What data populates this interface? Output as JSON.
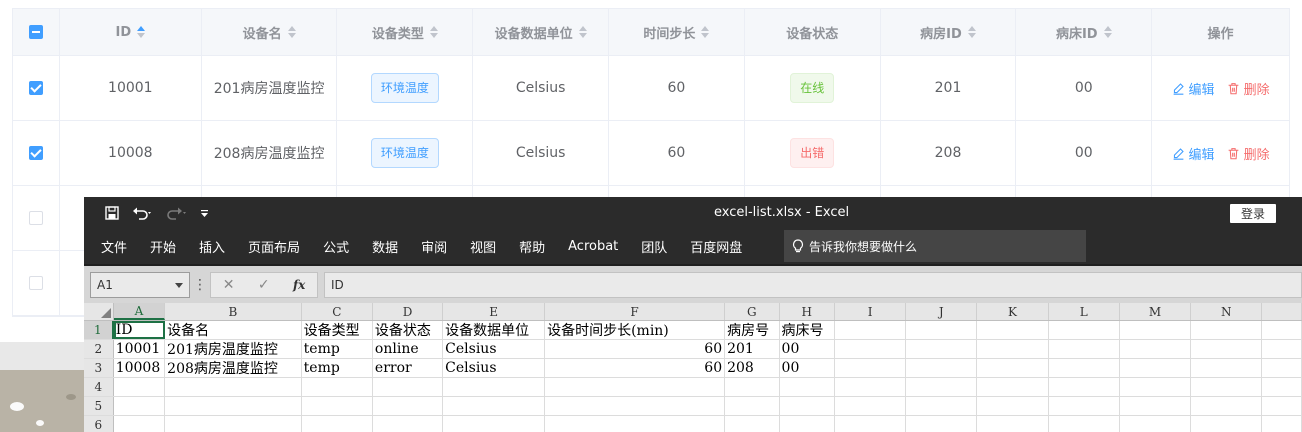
{
  "web_table": {
    "headers": {
      "id": "ID",
      "name": "设备名",
      "type": "设备类型",
      "unit": "设备数据单位",
      "step": "时间步长",
      "status": "设备状态",
      "room": "病房ID",
      "bed": "病床ID",
      "actions": "操作"
    },
    "rows": [
      {
        "checked": true,
        "id": "10001",
        "name": "201病房温度监控",
        "type": "环境温度",
        "unit": "Celsius",
        "step": "60",
        "status": "在线",
        "status_kind": "online",
        "room": "201",
        "bed": "00"
      },
      {
        "checked": true,
        "id": "10008",
        "name": "208病房温度监控",
        "type": "环境温度",
        "unit": "Celsius",
        "step": "60",
        "status": "出错",
        "status_kind": "error",
        "room": "208",
        "bed": "00"
      }
    ],
    "edit_label": "编辑",
    "delete_label": "删除",
    "accent_color": "#409eff",
    "danger_color": "#f56c6c"
  },
  "excel": {
    "window_title": "excel-list.xlsx  -  Excel",
    "login_label": "登录",
    "menu": [
      "文件",
      "开始",
      "插入",
      "页面布局",
      "公式",
      "数据",
      "审阅",
      "视图",
      "帮助",
      "Acrobat",
      "团队",
      "百度网盘"
    ],
    "tell_me_placeholder": "告诉我你想要做什么",
    "name_box": "A1",
    "formula_value": "ID",
    "fx_label": "fx",
    "columns": [
      "A",
      "B",
      "C",
      "D",
      "E",
      "F",
      "G",
      "H",
      "I",
      "J",
      "K",
      "L",
      "M",
      "N"
    ],
    "rows": [
      {
        "num": "1",
        "cells": [
          "ID",
          "设备名",
          "设备类型",
          "设备状态",
          "设备数据单位",
          "设备时间步长(min)",
          "病房号",
          "病床号"
        ]
      },
      {
        "num": "2",
        "cells": [
          "10001",
          "201病房温度监控",
          "temp",
          "online",
          "Celsius",
          "60",
          "201",
          "00"
        ]
      },
      {
        "num": "3",
        "cells": [
          "10008",
          "208病房温度监控",
          "temp",
          "error",
          "Celsius",
          "60",
          "208",
          "00"
        ]
      },
      {
        "num": "4",
        "cells": []
      },
      {
        "num": "5",
        "cells": []
      },
      {
        "num": "6",
        "cells": []
      }
    ]
  }
}
